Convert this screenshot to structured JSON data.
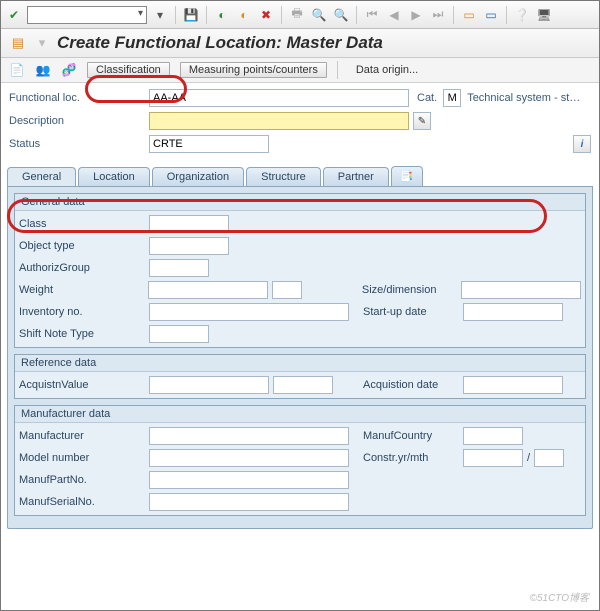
{
  "title": "Create Functional Location: Master Data",
  "sec_toolbar": {
    "classification": "Classification",
    "measuring": "Measuring points/counters",
    "data_origin": "Data origin..."
  },
  "header": {
    "func_loc_label": "Functional loc.",
    "func_loc_value": "AA-AA",
    "cat_label": "Cat.",
    "cat_value": "M",
    "cat_text": "Technical system - st…",
    "desc_label": "Description",
    "desc_value": "",
    "status_label": "Status",
    "status_value": "CRTE"
  },
  "tabs": [
    "General",
    "Location",
    "Organization",
    "Structure",
    "Partner"
  ],
  "groups": {
    "general": {
      "title": "General data",
      "class": "Class",
      "object_type": "Object type",
      "authoriz_group": "AuthorizGroup",
      "weight": "Weight",
      "size_dim": "Size/dimension",
      "inventory_no": "Inventory no.",
      "start_up": "Start-up date",
      "shift_note": "Shift Note Type"
    },
    "reference": {
      "title": "Reference data",
      "acq_value": "AcquistnValue",
      "acq_date": "Acquistion date"
    },
    "manufacturer": {
      "title": "Manufacturer data",
      "manufacturer": "Manufacturer",
      "manuf_country": "ManufCountry",
      "model_number": "Model number",
      "constr": "Constr.yr/mth",
      "manuf_part": "ManufPartNo.",
      "manuf_serial": "ManufSerialNo."
    }
  },
  "watermark": "©51CTO博客"
}
